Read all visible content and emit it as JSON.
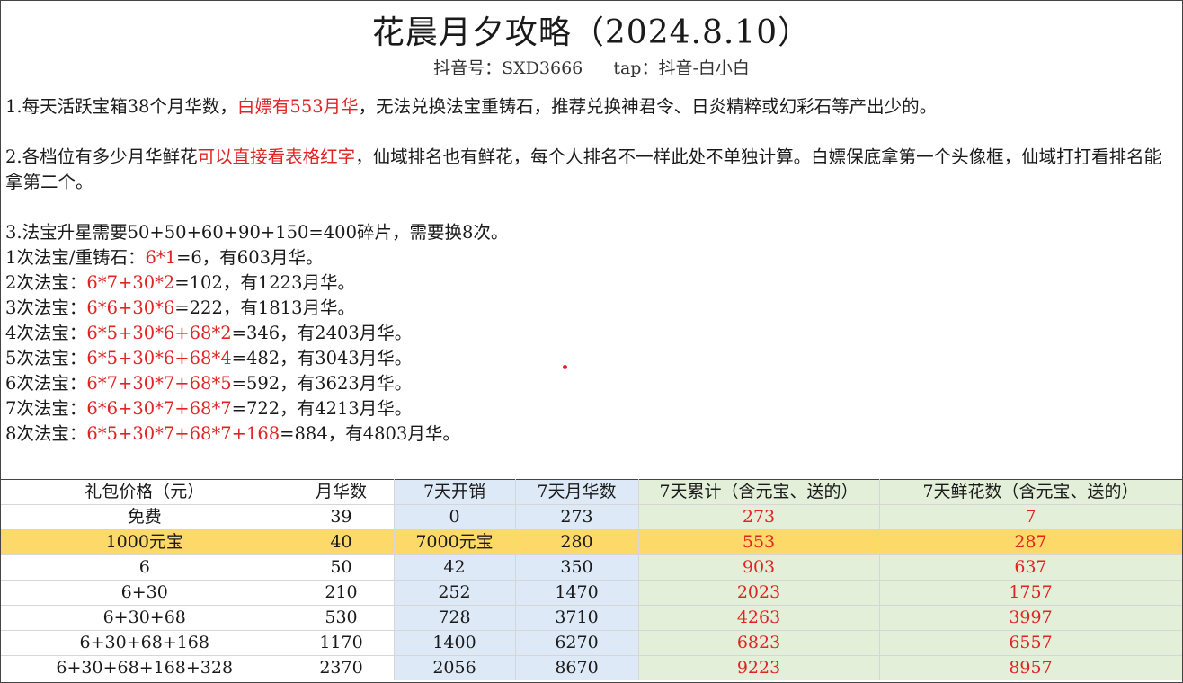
{
  "header": {
    "title": "花晨月夕攻略（2024.8.10）",
    "douyin": "抖音号：SXD3666",
    "tap": "tap：抖音-白小白"
  },
  "notes": {
    "p1": {
      "a": "1.每天活跃宝箱38个月华数，",
      "b": "白嫖有553月华",
      "c": "，无法兑换法宝重铸石，推荐兑换神君令、日炎精粹或幻彩石等产出少的。"
    },
    "p2": {
      "a": "2.各档位有多少月华鲜花",
      "b": "可以直接看表格红字",
      "c": "，仙域排名也有鲜花，每个人排名不一样此处不单独计算。白嫖保底拿第一个头像框，仙域打打看排名能拿第二个。"
    },
    "p3": "3.法宝升星需要50+50+60+90+150=400碎片，需要换8次。",
    "lines": [
      {
        "a": "1次法宝/重铸石：",
        "b": "6*1",
        "c": "=6，有603月华。"
      },
      {
        "a": "2次法宝：",
        "b": "6*7+30*2",
        "c": "=102，有1223月华。"
      },
      {
        "a": "3次法宝：",
        "b": "6*6+30*6",
        "c": "=222，有1813月华。"
      },
      {
        "a": "4次法宝：",
        "b": "6*5+30*6+68*2",
        "c": "=346，有2403月华。"
      },
      {
        "a": "5次法宝：",
        "b": "6*5+30*6+68*4",
        "c": "=482，有3043月华。"
      },
      {
        "a": "6次法宝：",
        "b": "6*7+30*7+68*5",
        "c": "=592，有3623月华。"
      },
      {
        "a": "7次法宝：",
        "b": "6*6+30*7+68*7",
        "c": "=722，有4213月华。"
      },
      {
        "a": "8次法宝：",
        "b": "6*5+30*7+68*7+168",
        "c": "=884，有4803月华。"
      }
    ]
  },
  "table": {
    "headers": [
      "礼包价格（元）",
      "月华数",
      "7天开销",
      "7天月华数",
      "7天累计（含元宝、送的）",
      "7天鲜花数（含元宝、送的）"
    ],
    "rows": [
      [
        "免费",
        "39",
        "0",
        "273",
        "273",
        "7"
      ],
      [
        "1000元宝",
        "40",
        "7000元宝",
        "280",
        "553",
        "287"
      ],
      [
        "6",
        "50",
        "42",
        "350",
        "903",
        "637"
      ],
      [
        "6+30",
        "210",
        "252",
        "1470",
        "2023",
        "1757"
      ],
      [
        "6+30+68",
        "530",
        "728",
        "3710",
        "4263",
        "3997"
      ],
      [
        "6+30+68+168",
        "1170",
        "1400",
        "6270",
        "6823",
        "6557"
      ],
      [
        "6+30+68+168+328",
        "2370",
        "2056",
        "8670",
        "9223",
        "8957"
      ]
    ],
    "highlight_row": 1
  },
  "colors": {
    "accent_red": "#e02424",
    "highlight": "#fcd968",
    "blue_col": "#dde9f6",
    "green_col": "#e3efd9"
  }
}
